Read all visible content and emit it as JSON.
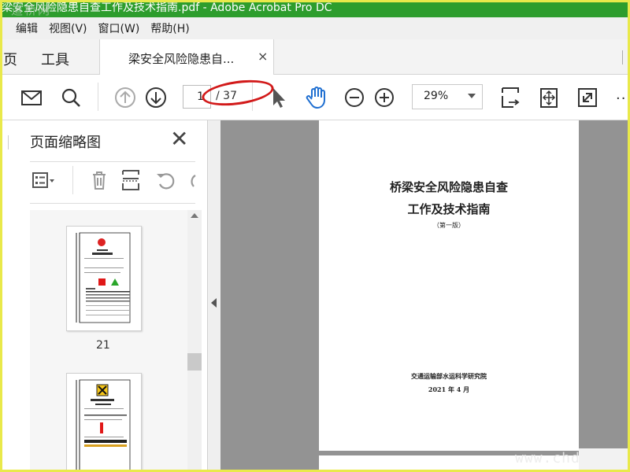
{
  "window": {
    "title": "梁安全风险隐患自查工作及技术指南.pdf - Adobe Acrobat Pro DC",
    "watermark_top": "道桥网"
  },
  "menu": [
    "编辑",
    "视图(V)",
    "窗口(W)",
    "帮助(H)"
  ],
  "tabs": {
    "home": "页",
    "tools": "工具",
    "document": "梁安全风险隐患自...",
    "close": "×"
  },
  "toolbar": {
    "page_current": "1",
    "page_total": "/ 37",
    "zoom": "29%",
    "more": "···"
  },
  "panel": {
    "title": "页面缩略图",
    "close": "✕",
    "thumbnails": [
      {
        "label": "21"
      },
      {
        "label": ""
      }
    ]
  },
  "document": {
    "title_line1": "桥梁安全风险隐患自查",
    "title_line2": "工作及技术指南",
    "edition": "（第一版）",
    "organization": "交通运输部水运科学研究院",
    "date": "2021 年 4 月"
  },
  "watermark_bottom": "www.chda"
}
